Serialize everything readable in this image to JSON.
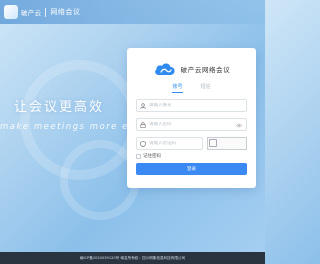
{
  "header": {
    "brand": "破产云",
    "title": "网络会议"
  },
  "hero": {
    "slogan_cn": "让会议更高效",
    "slogan_en": "make meetings more efficient"
  },
  "login": {
    "title": "破产云网络会议",
    "tabs": [
      {
        "label": "账号",
        "active": true
      },
      {
        "label": "短信",
        "active": false
      }
    ],
    "username_placeholder": "请输入账号",
    "password_placeholder": "请输入密码",
    "captcha_placeholder": "请输入验证码",
    "remember_label": "记住密码",
    "submit_label": "登录"
  },
  "footer": {
    "text": "赣ICP备2020039120号  域名所有权：四川明象信息科技有限公司"
  },
  "colors": {
    "accent": "#3b8af3",
    "footer_bg": "#2a3441",
    "panel_bg": "#ffffff"
  }
}
